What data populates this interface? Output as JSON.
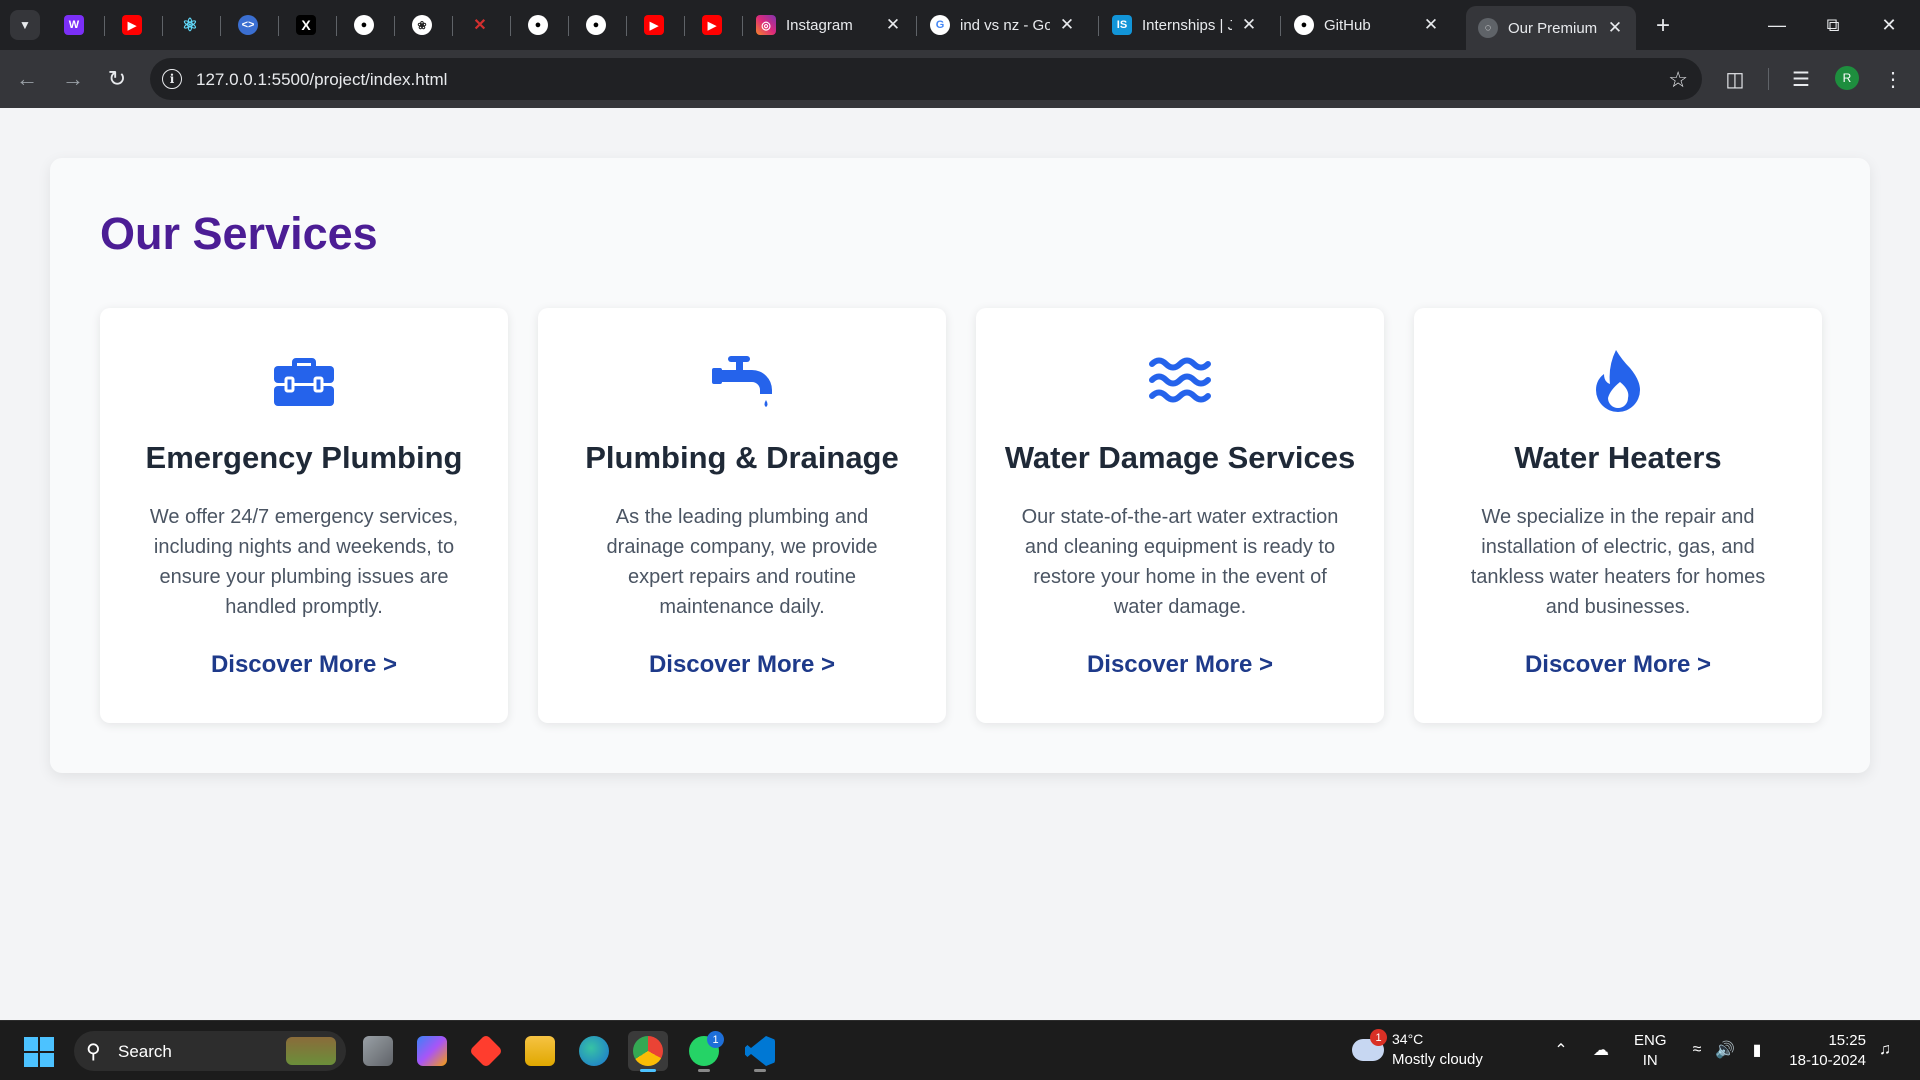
{
  "browser": {
    "pinned_tabs": [
      {
        "icon": "wix-icon",
        "glyph": "☉",
        "color": "#7b2ff7"
      },
      {
        "icon": "youtube-icon",
        "glyph": "▶",
        "color": "#ff0000"
      },
      {
        "icon": "react-icon",
        "glyph": "⚛",
        "color": "#3b82f6"
      },
      {
        "icon": "code-icon",
        "glyph": "‹›",
        "color": "#3b6fd1"
      },
      {
        "icon": "x-icon",
        "glyph": "X",
        "color": "#000000"
      },
      {
        "icon": "github-icon",
        "glyph": "●",
        "color": "#24292e"
      },
      {
        "icon": "chatgpt-icon",
        "glyph": "❀",
        "color": "#222222"
      },
      {
        "icon": "dev-icon",
        "glyph": "╳",
        "color": "#8b0000"
      },
      {
        "icon": "github-icon",
        "glyph": "●",
        "color": "#24292e"
      },
      {
        "icon": "github-icon",
        "glyph": "●",
        "color": "#24292e"
      },
      {
        "icon": "youtube-icon",
        "glyph": "▶",
        "color": "#ff0000"
      },
      {
        "icon": "youtube-icon",
        "glyph": "▶",
        "color": "#ff0000"
      }
    ],
    "tabs": [
      {
        "title": "Instagram",
        "icon": "instagram-icon",
        "glyph": "◎",
        "color": "#d62976",
        "active": false
      },
      {
        "title": "ind vs nz - Go",
        "icon": "google-icon",
        "glyph": "G",
        "color": "#4285f4",
        "active": false
      },
      {
        "title": "Internships | J",
        "icon": "internshala-icon",
        "glyph": "IS",
        "color": "#1295d8",
        "active": false
      },
      {
        "title": "GitHub",
        "icon": "github-icon",
        "glyph": "●",
        "color": "#24292e",
        "active": false
      },
      {
        "title": "Our Premium",
        "icon": "globe-icon",
        "glyph": "◌",
        "color": "#5f6368",
        "active": true
      }
    ],
    "url": "127.0.0.1:5500/project/index.html",
    "profile_initial": "R"
  },
  "page": {
    "title": "Our Services",
    "colors": {
      "title": "#4c1d95",
      "icon": "#2563eb",
      "link": "#1e3a8a"
    },
    "services": [
      {
        "title": "Emergency Plumbing",
        "description": "We offer 24/7 emergency services, including nights and weekends, to ensure your plumbing issues are handled promptly.",
        "link": "Discover More >",
        "icon": "toolbox-icon"
      },
      {
        "title": "Plumbing & Drainage",
        "description": "As the leading plumbing and drainage company, we provide expert repairs and routine maintenance daily.",
        "link": "Discover More >",
        "icon": "faucet-icon"
      },
      {
        "title": "Water Damage Services",
        "description": "Our state-of-the-art water extraction and cleaning equipment is ready to restore your home in the event of water damage.",
        "link": "Discover More >",
        "icon": "water-waves-icon"
      },
      {
        "title": "Water Heaters",
        "description": "We specialize in the repair and installation of electric, gas, and tankless water heaters for homes and businesses.",
        "link": "Discover More >",
        "icon": "fire-icon"
      }
    ]
  },
  "taskbar": {
    "search_label": "Search",
    "weather": {
      "temp": "34°C",
      "condition": "Mostly cloudy",
      "badge": "1"
    },
    "lang": {
      "line1": "ENG",
      "line2": "IN"
    },
    "clock": {
      "time": "15:25",
      "date": "18-10-2024"
    },
    "whatsapp_badge": "1"
  }
}
